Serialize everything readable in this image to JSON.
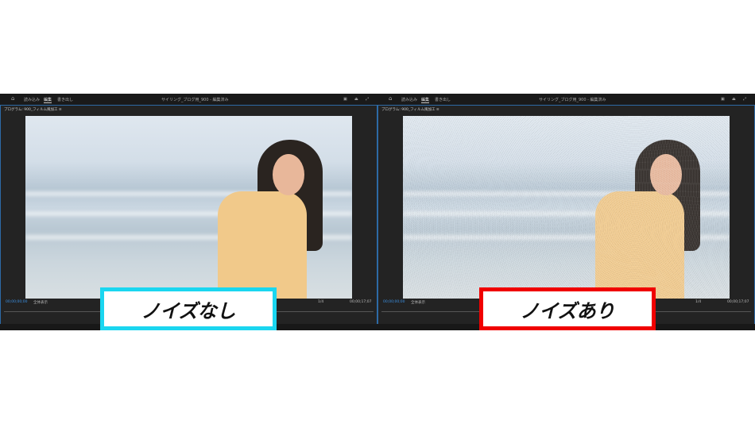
{
  "panes": [
    {
      "menu": {
        "import": "読み込み",
        "edit": "編集",
        "export": "書き出し"
      },
      "title": "サイリング_ブログ用_900 - 編集済み",
      "panel": "プログラム: 900_フィルム風加工 ≡",
      "timecode_start": "00;00;00;00",
      "fit": "全体表示",
      "resolution": "1/4",
      "timecode_end": "00;00;17;07",
      "noise": false
    },
    {
      "menu": {
        "import": "読み込み",
        "edit": "編集",
        "export": "書き出し"
      },
      "title": "サイリング_ブログ用_900 - 編集済み",
      "panel": "プログラム: 900_フィルム風加工 ≡",
      "timecode_start": "00;00;00;00",
      "fit": "全体表示",
      "resolution": "1/4",
      "timecode_end": "00;00;17;07",
      "noise": true
    }
  ],
  "labels": {
    "left": "ノイズなし",
    "right": "ノイズあり"
  },
  "colors": {
    "left_border": "#1ad6f0",
    "right_border": "#f00000",
    "accent": "#3b8fe0"
  }
}
